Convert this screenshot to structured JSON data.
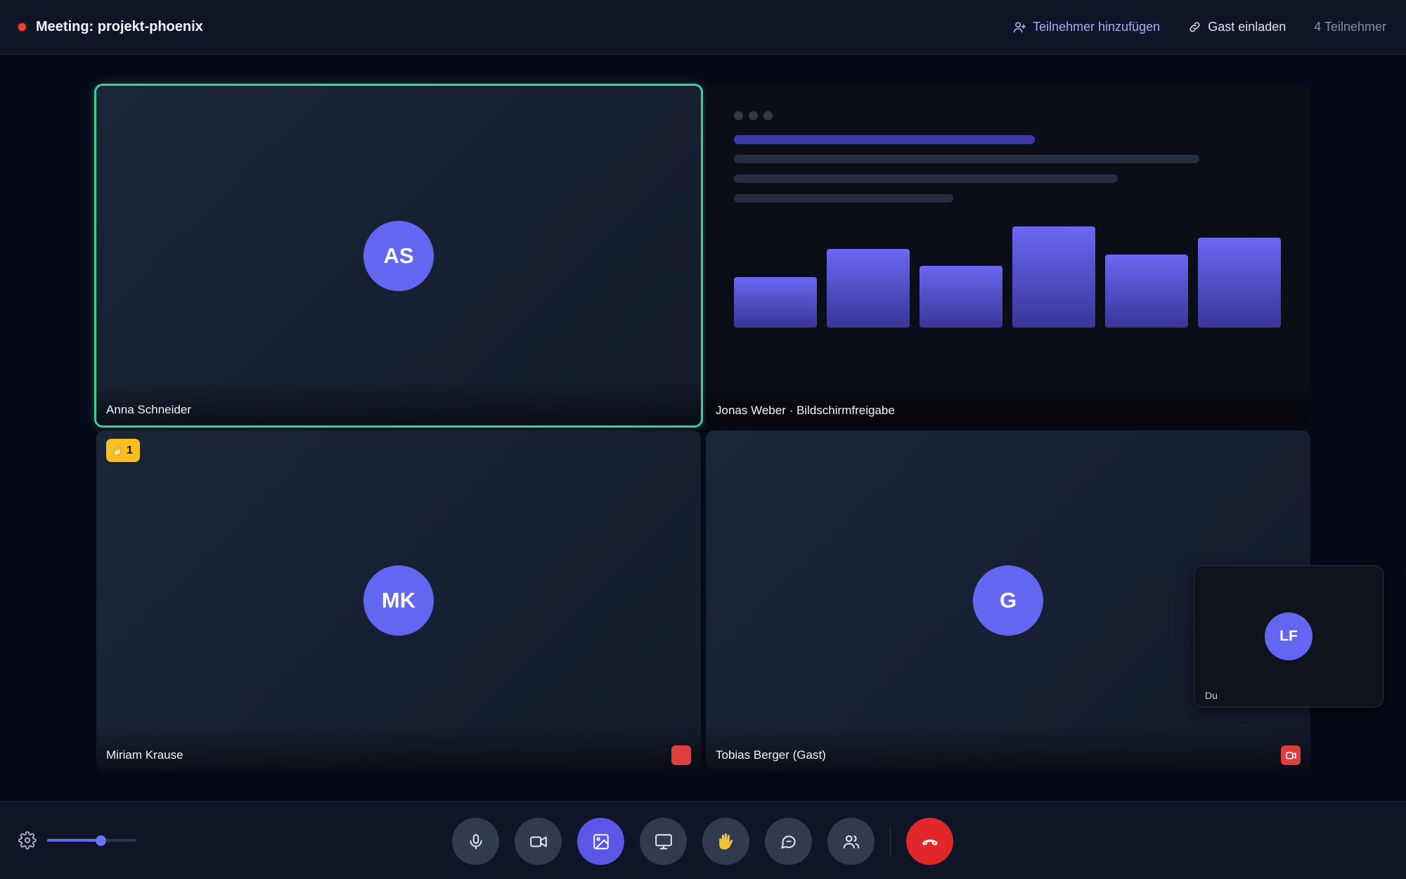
{
  "header": {
    "title": "Meeting: projekt-phoenix",
    "add_participant_label": "Teilnehmer hinzufügen",
    "invite_guest_label": "Gast einladen",
    "participant_count": "4 Teilnehmer"
  },
  "tiles": [
    {
      "name": "Anna Schneider",
      "initials": "AS",
      "speaking": true
    },
    {
      "name": "Jonas Weber · Bildschirmfreigabe",
      "screen_share": true
    },
    {
      "name": "Miriam Krause",
      "initials": "MK",
      "hand_raised_badge": "1",
      "hand_icon": "waving-hand-icon",
      "status_icon": "red-status-badge"
    },
    {
      "name": "Tobias Berger (Gast)",
      "initials": "G",
      "status_icon": "camera-off-icon"
    }
  ],
  "self_view": {
    "label": "Du",
    "initials": "LF"
  },
  "screen_share_chart": {
    "type": "bar",
    "values": [
      27,
      42,
      33,
      54,
      39,
      48
    ]
  },
  "controls": {
    "volume": 0.6,
    "buttons": [
      "microphone-icon",
      "camera-icon",
      "background-image-icon",
      "screen-share-icon",
      "raise-hand-icon",
      "chat-icon",
      "participants-icon",
      "end-call-icon"
    ],
    "active_button": "background-image-icon"
  },
  "colors": {
    "accent": "#6366f1",
    "speaking_border": "#3ecf96",
    "end_call": "#e0272a",
    "hand_badge": "#f8bf23",
    "recording_dot": "#ef3b3b"
  }
}
